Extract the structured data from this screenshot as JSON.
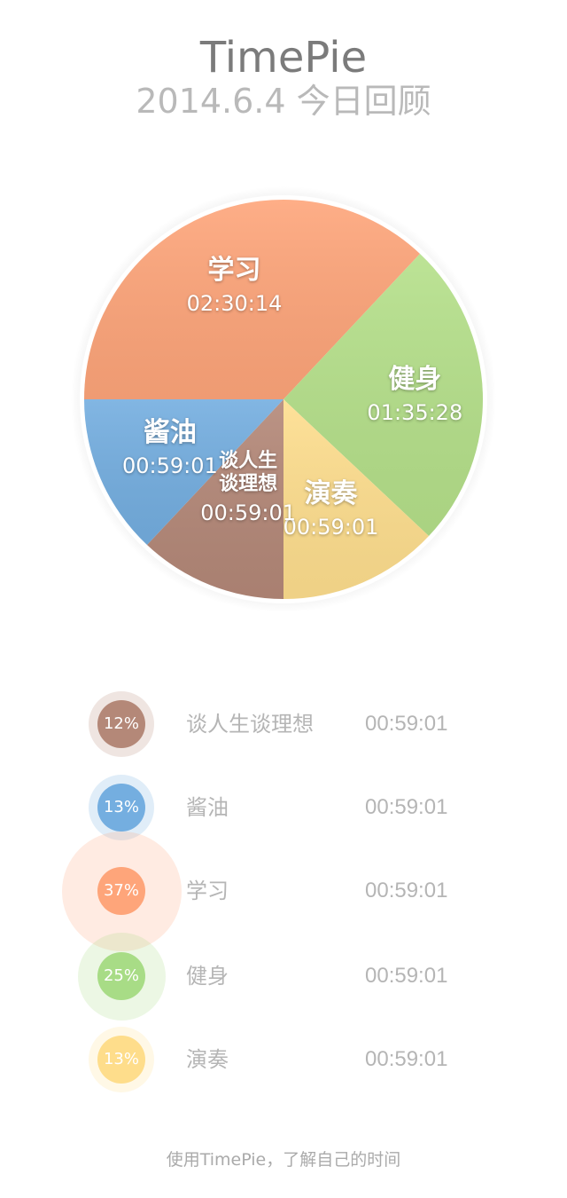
{
  "header": {
    "app_title": "TimePie",
    "subtitle": "2014.6.4 今日回顾"
  },
  "chart_data": {
    "type": "pie",
    "slices": [
      {
        "name": "学习",
        "time": "02:30:14",
        "percent": 37,
        "color": "#fea57a"
      },
      {
        "name": "健身",
        "time": "01:35:28",
        "percent": 25,
        "color": "#b5e08a"
      },
      {
        "name": "演奏",
        "time": "00:59:01",
        "percent": 13,
        "color": "#fede8e"
      },
      {
        "name": "谈人生\n谈理想",
        "time": "00:59:01",
        "percent": 12,
        "color": "#b48878"
      },
      {
        "name": "酱油",
        "time": "00:59:01",
        "percent": 13,
        "color": "#74aee0"
      }
    ]
  },
  "legend": [
    {
      "pct": "12%",
      "name": "谈人生谈理想",
      "time": "00:59:01",
      "color": "#b48878"
    },
    {
      "pct": "13%",
      "name": "酱油",
      "time": "00:59:01",
      "color": "#74aee0"
    },
    {
      "pct": "37%",
      "name": "学习",
      "time": "00:59:01",
      "color": "#fea57a"
    },
    {
      "pct": "25%",
      "name": "健身",
      "time": "00:59:01",
      "color": "#a8dc86"
    },
    {
      "pct": "13%",
      "name": "演奏",
      "time": "00:59:01",
      "color": "#fedd8b"
    }
  ],
  "footer": "使用TimePie，了解自己的时间"
}
